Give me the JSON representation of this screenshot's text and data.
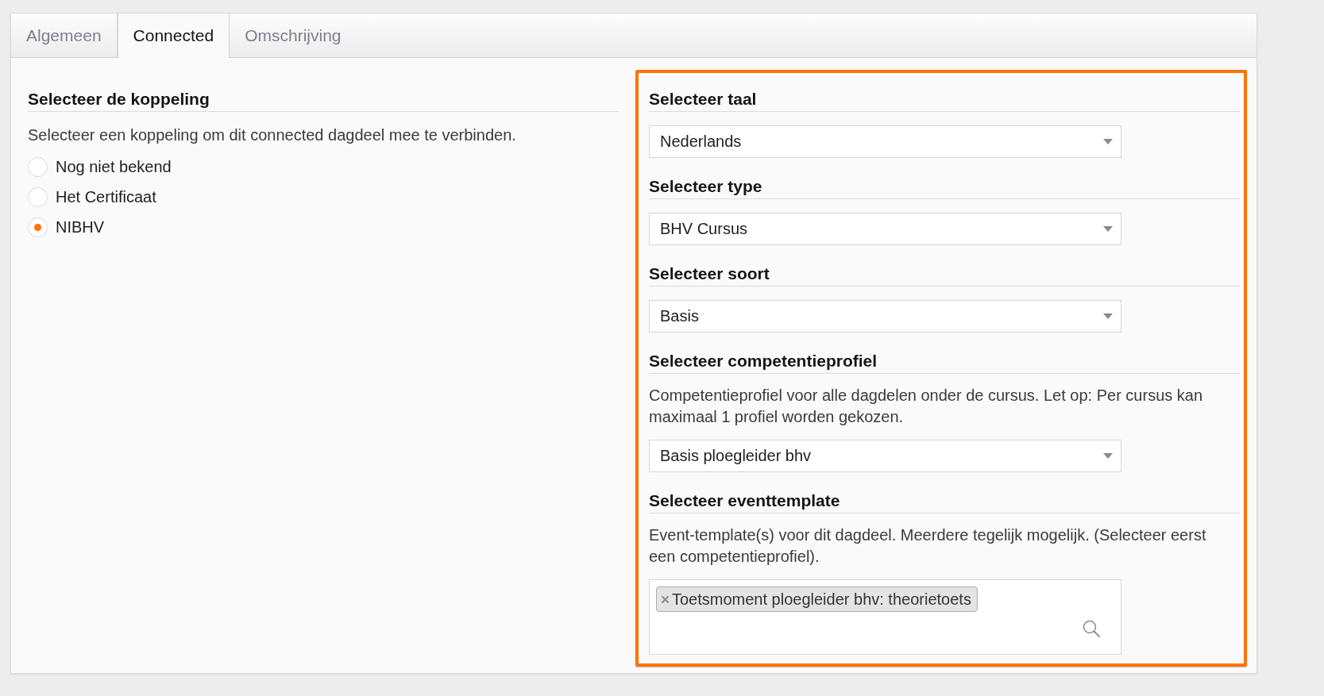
{
  "tabs": [
    {
      "label": "Algemeen",
      "selected": false
    },
    {
      "label": "Connected",
      "selected": true
    },
    {
      "label": "Omschrijving",
      "selected": false
    }
  ],
  "koppeling": {
    "heading": "Selecteer de koppeling",
    "description": "Selecteer een koppeling om dit connected dagdeel mee te verbinden.",
    "options": [
      {
        "label": "Nog niet bekend",
        "selected": false
      },
      {
        "label": "Het Certificaat",
        "selected": false
      },
      {
        "label": "NIBHV",
        "selected": true
      }
    ]
  },
  "settings": {
    "highlighted": true,
    "sections": [
      {
        "kind": "select",
        "heading": "Selecteer taal",
        "value": "Nederlands"
      },
      {
        "kind": "select",
        "heading": "Selecteer type",
        "value": "BHV Cursus"
      },
      {
        "kind": "select",
        "heading": "Selecteer soort",
        "value": "Basis"
      },
      {
        "kind": "select",
        "heading": "Selecteer competentieprofiel",
        "description": "Competentieprofiel voor alle dagdelen onder de cursus. Let op: Per cursus kan maximaal 1 profiel worden gekozen.",
        "value": "Basis ploegleider bhv"
      },
      {
        "kind": "multiselect",
        "heading": "Selecteer eventtemplate",
        "description": "Event-template(s) voor dit dagdeel. Meerdere tegelijk mogelijk. (Selecteer eerst een competentieprofiel).",
        "tags": [
          "Toetsmoment ploegleider bhv: theorietoets"
        ]
      }
    ]
  }
}
